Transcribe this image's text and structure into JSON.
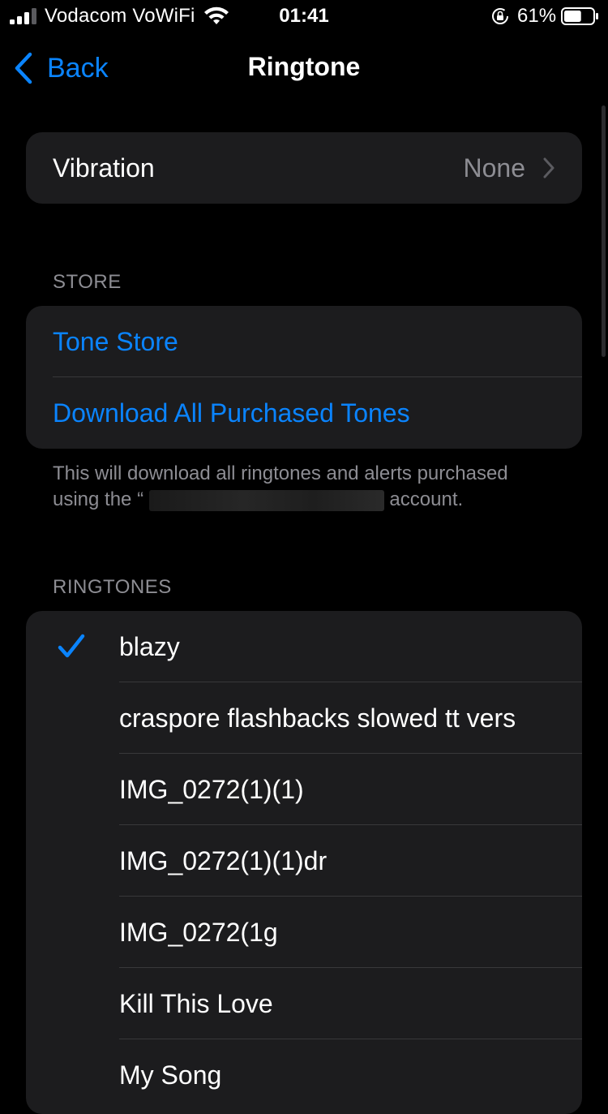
{
  "status_bar": {
    "carrier": "Vodacom VoWiFi",
    "time": "01:41",
    "battery_percent": "61%",
    "signal_bars_active": 3,
    "signal_bars_total": 4,
    "battery_level": 0.61
  },
  "nav": {
    "back_label": "Back",
    "title": "Ringtone"
  },
  "vibration": {
    "label": "Vibration",
    "value": "None"
  },
  "store": {
    "header": "STORE",
    "items": [
      {
        "label": "Tone Store"
      },
      {
        "label": "Download All Purchased Tones"
      }
    ],
    "footer_before": "This will download all ringtones and alerts purchased using the “",
    "footer_after": "account."
  },
  "ringtones": {
    "header": "RINGTONES",
    "items": [
      {
        "label": "blazy",
        "selected": true
      },
      {
        "label": "craspore flashbacks slowed tt vers",
        "selected": false
      },
      {
        "label": "IMG_0272(1)(1)",
        "selected": false
      },
      {
        "label": "IMG_0272(1)(1)dr",
        "selected": false
      },
      {
        "label": "IMG_0272(1g",
        "selected": false
      },
      {
        "label": "Kill This Love",
        "selected": false
      },
      {
        "label": "My Song",
        "selected": false
      }
    ]
  },
  "colors": {
    "accent": "#0a84ff",
    "background": "#000000",
    "cell_background": "#1c1c1e",
    "secondary_text": "#8d8d93",
    "separator": "#38383a"
  },
  "icons": {
    "signal": "cellular-signal-icon",
    "wifi": "wifi-icon",
    "orientation_lock": "orientation-lock-icon",
    "battery": "battery-icon",
    "back": "chevron-left-icon",
    "disclosure": "chevron-right-icon",
    "selected": "checkmark-icon"
  }
}
